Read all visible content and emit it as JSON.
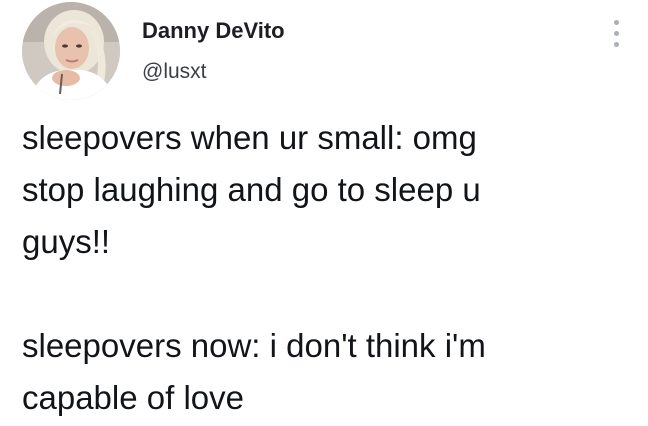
{
  "author": {
    "display_name": "Danny DeVito",
    "handle": "@lusxt",
    "avatar_icon": "avatar-photo"
  },
  "menu": {
    "icon": "more-vertical-icon"
  },
  "tweet": {
    "paragraph_1": [
      "sleepovers when ur small: omg",
      "stop laughing and go to sleep u",
      "guys!!"
    ],
    "paragraph_2": [
      "sleepovers now: i don't think i'm",
      "capable of love"
    ]
  }
}
